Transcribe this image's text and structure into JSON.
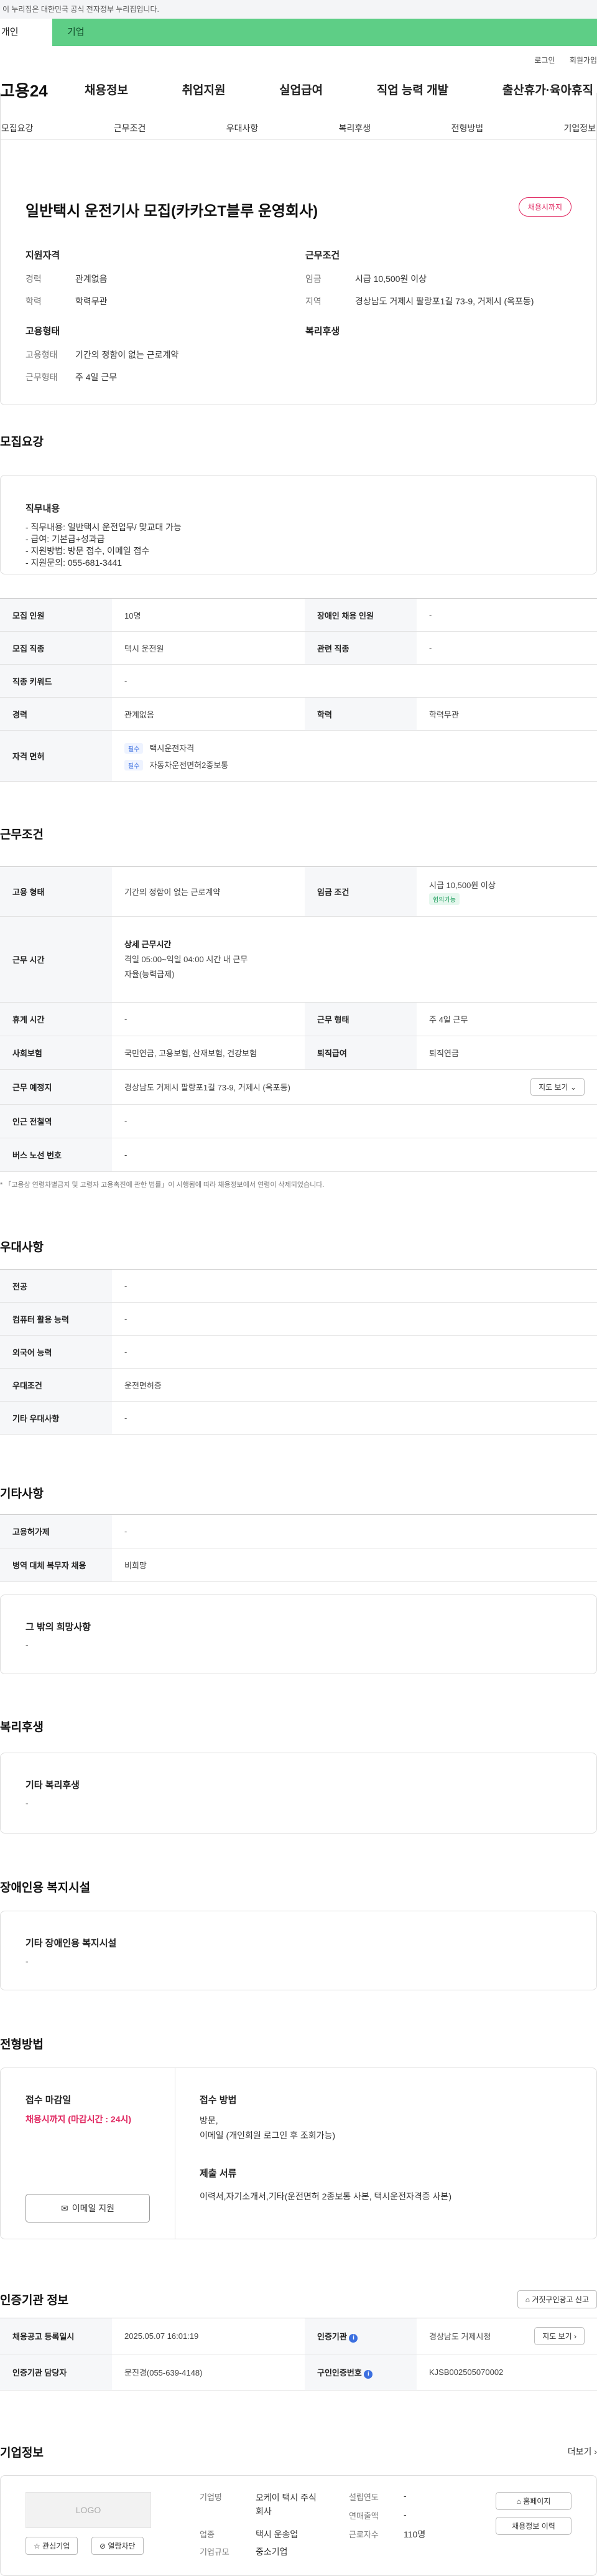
{
  "top_notice": "이 누리집은 대한민국 공식 전자정부 누리집입니다.",
  "gov_tabs": {
    "personal": "개인",
    "company": "기업"
  },
  "util": {
    "login": "로그인",
    "join": "회원가입"
  },
  "logo": "고용24",
  "gnb": [
    "채용정보",
    "취업지원",
    "실업급여",
    "직업 능력 개발",
    "출산휴가·육아휴직"
  ],
  "subnav": [
    "모집요강",
    "근무조건",
    "우대사항",
    "복리후생",
    "전형방법",
    "기업정보"
  ],
  "summary": {
    "title": "일반택시 운전기사 모집(카카오T블루 운영회사)",
    "badge": "채용시까지",
    "qualification": {
      "heading": "지원자격",
      "rows": [
        {
          "k": "경력",
          "v": "관계없음"
        },
        {
          "k": "학력",
          "v": "학력무관"
        }
      ]
    },
    "conditions": {
      "heading": "근무조건",
      "rows": [
        {
          "k": "임금",
          "v": "시급 10,500원 이상"
        },
        {
          "k": "지역",
          "v": "경상남도 거제시 팔랑포1길 73-9, 거제시 (옥포동)"
        }
      ]
    },
    "employment": {
      "heading": "고용형태",
      "rows": [
        {
          "k": "고용형태",
          "v": "기간의 정함이 없는 근로계약"
        },
        {
          "k": "근무형태",
          "v": "주 4일 근무"
        }
      ]
    },
    "welfare_heading": "복리후생"
  },
  "recruit": {
    "title": "모집요강",
    "box_title": "직무내용",
    "box_lines": [
      "- 직무내용: 일반택시 운전업무/ 맞교대 가능",
      "- 급여: 기본급+성과급",
      "- 지원방법: 방문 접수, 이메일 접수",
      "- 지원문의: 055-681-3441"
    ],
    "table": {
      "headcount_k": "모집 인원",
      "headcount_v": "10명",
      "disabled_k": "장애인 채용 인원",
      "disabled_v": "-",
      "job_k": "모집 직종",
      "job_v": "택시 운전원",
      "related_k": "관련 직종",
      "related_v": "-",
      "keyword_k": "직종 키워드",
      "keyword_v": "-",
      "career_k": "경력",
      "career_v": "관계없음",
      "edu_k": "학력",
      "edu_v": "학력무관",
      "license_k": "자격 면허",
      "license_tag": "필수",
      "licenses": [
        "택시운전자격",
        "자동차운전면허2종보통"
      ]
    }
  },
  "work": {
    "title": "근무조건",
    "emp_k": "고용 형태",
    "emp_v": "기간의 정함이 없는 근로계약",
    "wage_k": "임금 조건",
    "wage_v": "시급 10,500원 이상",
    "wage_tag": "협의가능",
    "hours_k": "근무 시간",
    "hours_title": "상세 근무시간",
    "hours_l1": "격일 05:00~익일 04:00 시간 내 근무",
    "hours_l2": "자율(능력급제)",
    "rest_k": "휴게 시간",
    "rest_v": "-",
    "worktype_k": "근무 형태",
    "worktype_v": "주 4일 근무",
    "insurance_k": "사회보험",
    "insurance_v": "국민연금, 고용보험, 산재보험, 건강보험",
    "severance_k": "퇴직급여",
    "severance_v": "퇴직연금",
    "location_k": "근무 예정지",
    "location_v": "경상남도 거제시 팔랑포1길 73-9, 거제시 (옥포동)",
    "map_btn": "지도 보기",
    "subway_k": "인근 전철역",
    "subway_v": "-",
    "bus_k": "버스 노선 번호",
    "bus_v": "-",
    "note": "* 「고용상 연령차별금지 및 고령자 고용촉진에 관한 법률」이 시행됨에 따라 채용정보에서 연령이 삭제되었습니다."
  },
  "pref": {
    "title": "우대사항",
    "rows": [
      {
        "k": "전공",
        "v": "-"
      },
      {
        "k": "컴퓨터 활용 능력",
        "v": "-"
      },
      {
        "k": "외국어 능력",
        "v": "-"
      },
      {
        "k": "우대조건",
        "v": "운전면허증"
      },
      {
        "k": "기타 우대사항",
        "v": "-"
      }
    ]
  },
  "etc": {
    "title": "기타사항",
    "rows": [
      {
        "k": "고용허가제",
        "v": "-"
      },
      {
        "k": "병역 대체 복무자 채용",
        "v": "비희망"
      }
    ],
    "box_title": "그 밖의 희망사항",
    "box_v": "-"
  },
  "welfare": {
    "title": "복리후생",
    "box_title": "기타 복리후생",
    "box_v": "-"
  },
  "facility": {
    "title": "장애인용 복지시설",
    "box_title": "기타 장애인용 복지시설",
    "box_v": "-"
  },
  "selection": {
    "title": "전형방법",
    "deadline_k": "접수 마감일",
    "deadline_v": "채용시까지 (마감시간 : 24시)",
    "email_btn": "이메일 지원",
    "method_k": "접수 방법",
    "method_l1": "방문,",
    "method_l2": "이메일 (개인회원 로그인 후 조회가능)",
    "docs_k": "제출 서류",
    "docs_v": "이력서,자기소개서,기타(운전면허 2종보통 사본, 택시운전자격증 사본)"
  },
  "cert": {
    "title": "인증기관 정보",
    "report_btn": "거짓구인광고 신고",
    "reg_k": "채용공고 등록일시",
    "reg_v": "2025.05.07 16:01:19",
    "org_k": "인증기관",
    "org_v": "경상남도 거제시청",
    "map_btn": "지도 보기",
    "mgr_k": "인증기관 담당자",
    "mgr_v": "문진경(055-639-4148)",
    "no_k": "구인인증번호",
    "no_v": "KJSB002505070002"
  },
  "company": {
    "title": "기업정보",
    "more": "더보기",
    "logo_text": "LOGO",
    "interest_btn": "관심기업",
    "block_btn": "열람차단",
    "name_k": "기업명",
    "name_v": "오케이 택시 주식회사",
    "industry_k": "업종",
    "industry_v": "택시 운송업",
    "size_k": "기업규모",
    "size_v": "중소기업",
    "founded_k": "설립연도",
    "founded_v": "-",
    "sales_k": "연매출액",
    "sales_v": "-",
    "employees_k": "근로자수",
    "employees_v": "110명",
    "homepage_btn": "홈페이지",
    "history_btn": "채용정보 이력"
  }
}
